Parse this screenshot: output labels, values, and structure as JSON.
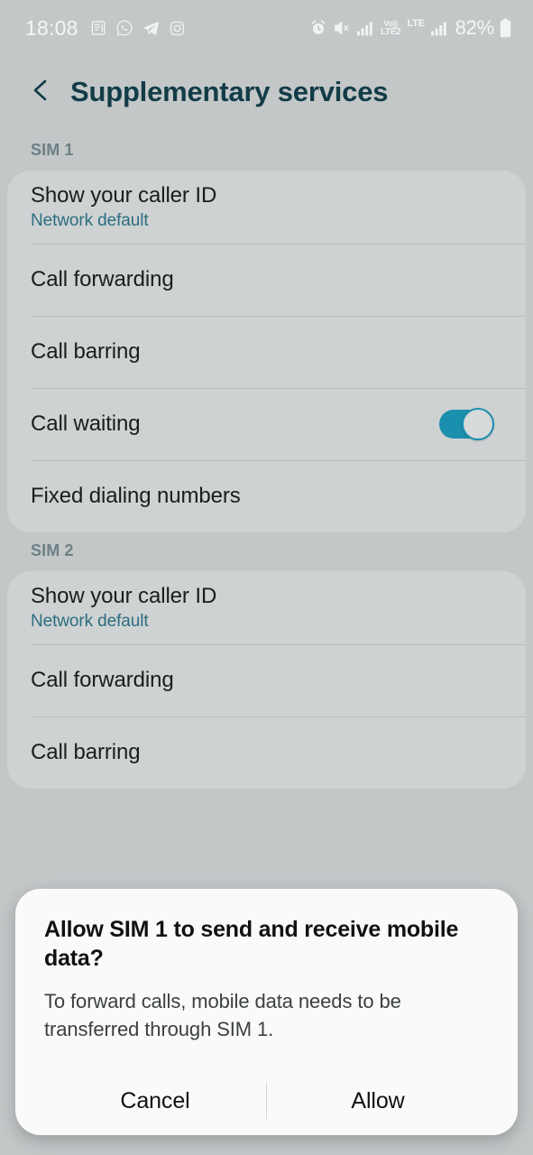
{
  "status_bar": {
    "time": "18:08",
    "battery_percent": "82%",
    "left_icons": [
      "news-icon",
      "whatsapp-icon",
      "telegram-icon",
      "instagram-icon"
    ],
    "right_icons": [
      "alarm-icon",
      "mute-icon",
      "signal-bars-icon",
      "volte2-icon",
      "lte-icon",
      "signal-bars-icon",
      "battery-icon"
    ],
    "volte_top": "Vo))",
    "volte_bottom": "LTE2",
    "lte_top": "LTE",
    "lte_bottom": "↓↑"
  },
  "header": {
    "back_icon": "chevron-left-icon",
    "title": "Supplementary services",
    "title_color": "#123c47"
  },
  "sections": [
    {
      "label": "SIM 1",
      "rows": [
        {
          "title": "Show your caller ID",
          "subtitle": "Network default",
          "toggle": null
        },
        {
          "title": "Call forwarding",
          "subtitle": null,
          "toggle": null
        },
        {
          "title": "Call barring",
          "subtitle": null,
          "toggle": null
        },
        {
          "title": "Call waiting",
          "subtitle": null,
          "toggle": "on"
        },
        {
          "title": "Fixed dialing numbers",
          "subtitle": null,
          "toggle": null
        }
      ]
    },
    {
      "label": "SIM 2",
      "rows": [
        {
          "title": "Show your caller ID",
          "subtitle": "Network default",
          "toggle": null
        },
        {
          "title": "Call forwarding",
          "subtitle": null,
          "toggle": null
        },
        {
          "title": "Call barring",
          "subtitle": null,
          "toggle": null
        }
      ]
    }
  ],
  "dialog": {
    "title": "Allow SIM 1 to send and receive mobile data?",
    "body": "To forward calls, mobile data needs to be transferred through SIM 1.",
    "cancel_label": "Cancel",
    "allow_label": "Allow"
  },
  "colors": {
    "page_background": "#c3c7c8",
    "card_background": "#cfd2d3",
    "accent_teal": "#1b8fae",
    "subtitle_teal": "#2b6e80",
    "section_label": "#6d7f84",
    "dialog_background": "#fafafa"
  }
}
